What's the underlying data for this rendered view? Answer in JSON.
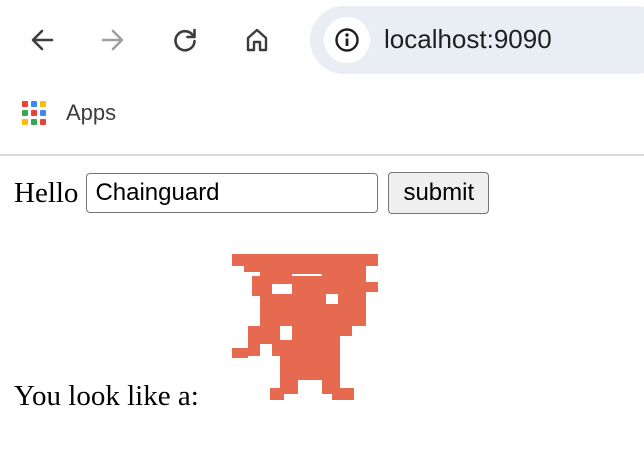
{
  "browser": {
    "url": "localhost:9090",
    "back_icon": "arrow-left",
    "forward_icon": "arrow-right",
    "reload_icon": "reload",
    "home_icon": "home",
    "site_info_icon": "info-circle"
  },
  "bookmarks": {
    "apps_label": "Apps",
    "apps_colors": [
      "#ea4335",
      "#4285f4",
      "#fbbc05",
      "#34a853",
      "#ea4335",
      "#4285f4",
      "#fbbc05",
      "#34a853",
      "#ea4335"
    ]
  },
  "form": {
    "hello_label": "Hello",
    "name_value": "Chainguard",
    "submit_label": "submit"
  },
  "result": {
    "label": "You look like a:",
    "monster_color": "#e66a4f",
    "monster_icon": "pixel-monster"
  }
}
